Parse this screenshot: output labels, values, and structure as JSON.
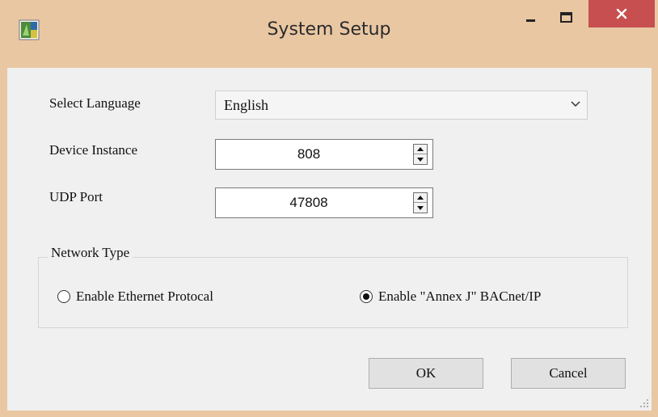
{
  "window": {
    "title": "System Setup"
  },
  "colors": {
    "titlebar": "#e9c7a3",
    "close_button": "#c74f4f",
    "client_bg": "#f0f0f0"
  },
  "icons": {
    "app": "app-icon",
    "minimize": "minimize-icon",
    "maximize": "maximize-icon",
    "close": "close-icon"
  },
  "language": {
    "label": "Select Language",
    "value": "English"
  },
  "device_instance": {
    "label": "Device Instance",
    "value": "808"
  },
  "udp_port": {
    "label": "UDP Port",
    "value": "47808"
  },
  "network_type": {
    "title": "Network Type",
    "options": [
      {
        "label": "Enable Ethernet Protocal",
        "checked": false
      },
      {
        "label": "Enable \"Annex J\" BACnet/IP",
        "checked": true
      }
    ]
  },
  "buttons": {
    "ok": "OK",
    "cancel": "Cancel"
  }
}
